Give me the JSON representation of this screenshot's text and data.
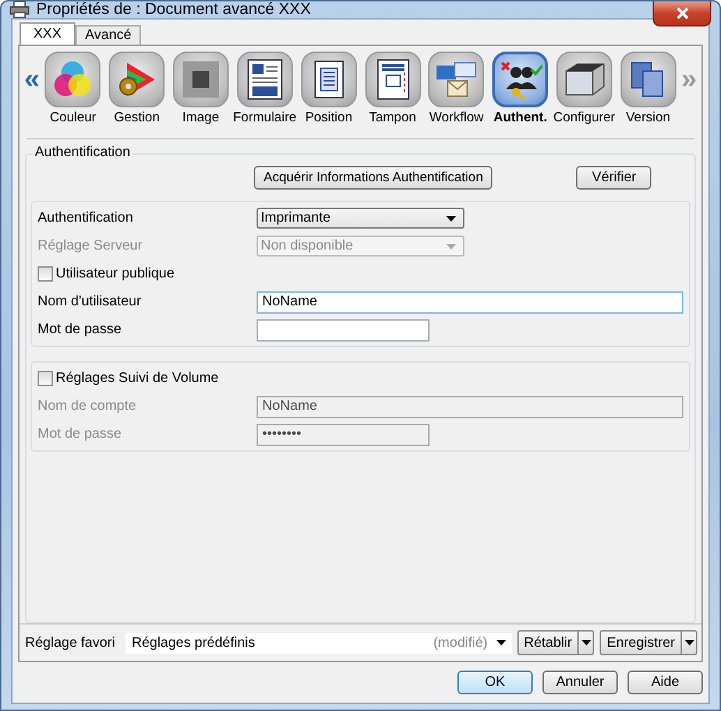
{
  "window": {
    "title": "Propriétés de : Document avancé XXX"
  },
  "tabs": [
    {
      "label": "XXX",
      "selected": true
    },
    {
      "label": "Avancé",
      "selected": false
    }
  ],
  "nav": {
    "prev": {
      "label": "«",
      "disabled": false
    },
    "next": {
      "label": "»",
      "disabled": true
    }
  },
  "categories": [
    {
      "label": "Couleur",
      "selected": false
    },
    {
      "label": "Gestion",
      "selected": false
    },
    {
      "label": "Image",
      "selected": false
    },
    {
      "label": "Formulaire",
      "selected": false
    },
    {
      "label": "Position",
      "selected": false
    },
    {
      "label": "Tampon",
      "selected": false
    },
    {
      "label": "Workflow",
      "selected": false
    },
    {
      "label": "Authent.",
      "selected": true
    },
    {
      "label": "Configurer",
      "selected": false
    },
    {
      "label": "Version",
      "selected": false
    }
  ],
  "group": {
    "title": "Authentification",
    "acquire_button": "Acquérir Informations Authentification",
    "verify_button": "Vérifier"
  },
  "auth_box": {
    "rows": [
      {
        "kind": "select",
        "label": "Authentification",
        "value": "Imprimante",
        "disabled": false
      },
      {
        "kind": "select",
        "label": "Réglage Serveur",
        "value": "Non disponible",
        "disabled": true
      },
      {
        "kind": "checkbox",
        "label": "Utilisateur publique",
        "checked": false
      },
      {
        "kind": "text",
        "label": "Nom d'utilisateur",
        "value": "NoName",
        "disabled": false,
        "wide": true
      },
      {
        "kind": "text",
        "label": "Mot de passe",
        "disabled": false,
        "wide": false
      }
    ]
  },
  "volume_box": {
    "rows": [
      {
        "kind": "checkbox",
        "label": "Réglages Suivi de Volume",
        "checked": false
      },
      {
        "kind": "text",
        "label": "Nom de compte",
        "value": "NoName",
        "disabled": true,
        "wide": true
      },
      {
        "kind": "text",
        "label": "Mot de passe",
        "value": "••••••••",
        "disabled": true,
        "wide": false
      }
    ]
  },
  "favorite": {
    "label": "Réglage favori",
    "value": "Réglages prédéfinis",
    "note": "(modifié)",
    "restore_button": "Rétablir",
    "save_button": "Enregistrer"
  },
  "buttons": [
    {
      "label": "OK",
      "default": true
    },
    {
      "label": "Annuler",
      "default": false
    },
    {
      "label": "Aide",
      "default": false
    }
  ]
}
